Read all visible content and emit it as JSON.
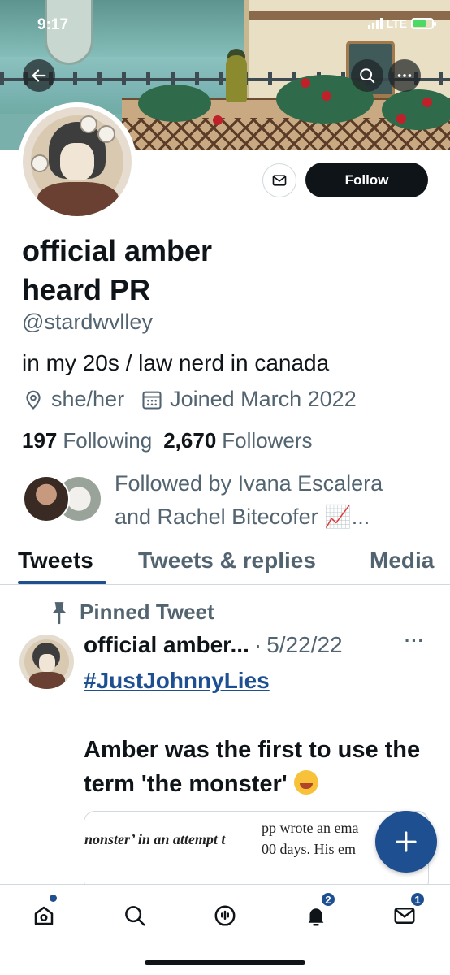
{
  "status_bar": {
    "time": "9:17",
    "network": "LTE"
  },
  "header": {
    "back_icon": "arrow-left-icon",
    "search_icon": "search-icon",
    "more_icon": "more-horizontal-icon"
  },
  "profile": {
    "display_name": "official amber heard PR",
    "handle": "@stardwvlley",
    "bio": "in my 20s / law nerd in canada",
    "pronouns": "she/her",
    "joined": "Joined March 2022",
    "following_count": "197",
    "following_label": "Following",
    "followers_count": "2,670",
    "followers_label": "Followers",
    "followed_by_line1": "Followed by Ivana Escalera",
    "followed_by_line2": "and Rachel Bitecofer 📈...",
    "follow_button": "Follow"
  },
  "tabs": [
    {
      "label": "Tweets",
      "active": true
    },
    {
      "label": "Tweets & replies",
      "active": false
    },
    {
      "label": "Media",
      "active": false
    }
  ],
  "tweet": {
    "pinned_label": "Pinned Tweet",
    "author": "official amber...",
    "separator": "·",
    "date": "5/22/22",
    "more": "···",
    "hashtag": "#JustJohnnyLies",
    "body": "Amber was the first to use the term 'the monster'",
    "quote_line1": "nonster’ in an attempt t",
    "quote_line2": "pp wrote an ema",
    "quote_line3": "00 days. His em"
  },
  "bottom_nav": {
    "items": [
      {
        "name": "home-icon"
      },
      {
        "name": "search-icon"
      },
      {
        "name": "spaces-icon"
      },
      {
        "name": "notifications-icon",
        "badge": "2"
      },
      {
        "name": "messages-icon",
        "badge": "1"
      }
    ]
  },
  "colors": {
    "accent": "#1d4f91",
    "text": "#0f1419",
    "secondary": "#536471"
  }
}
